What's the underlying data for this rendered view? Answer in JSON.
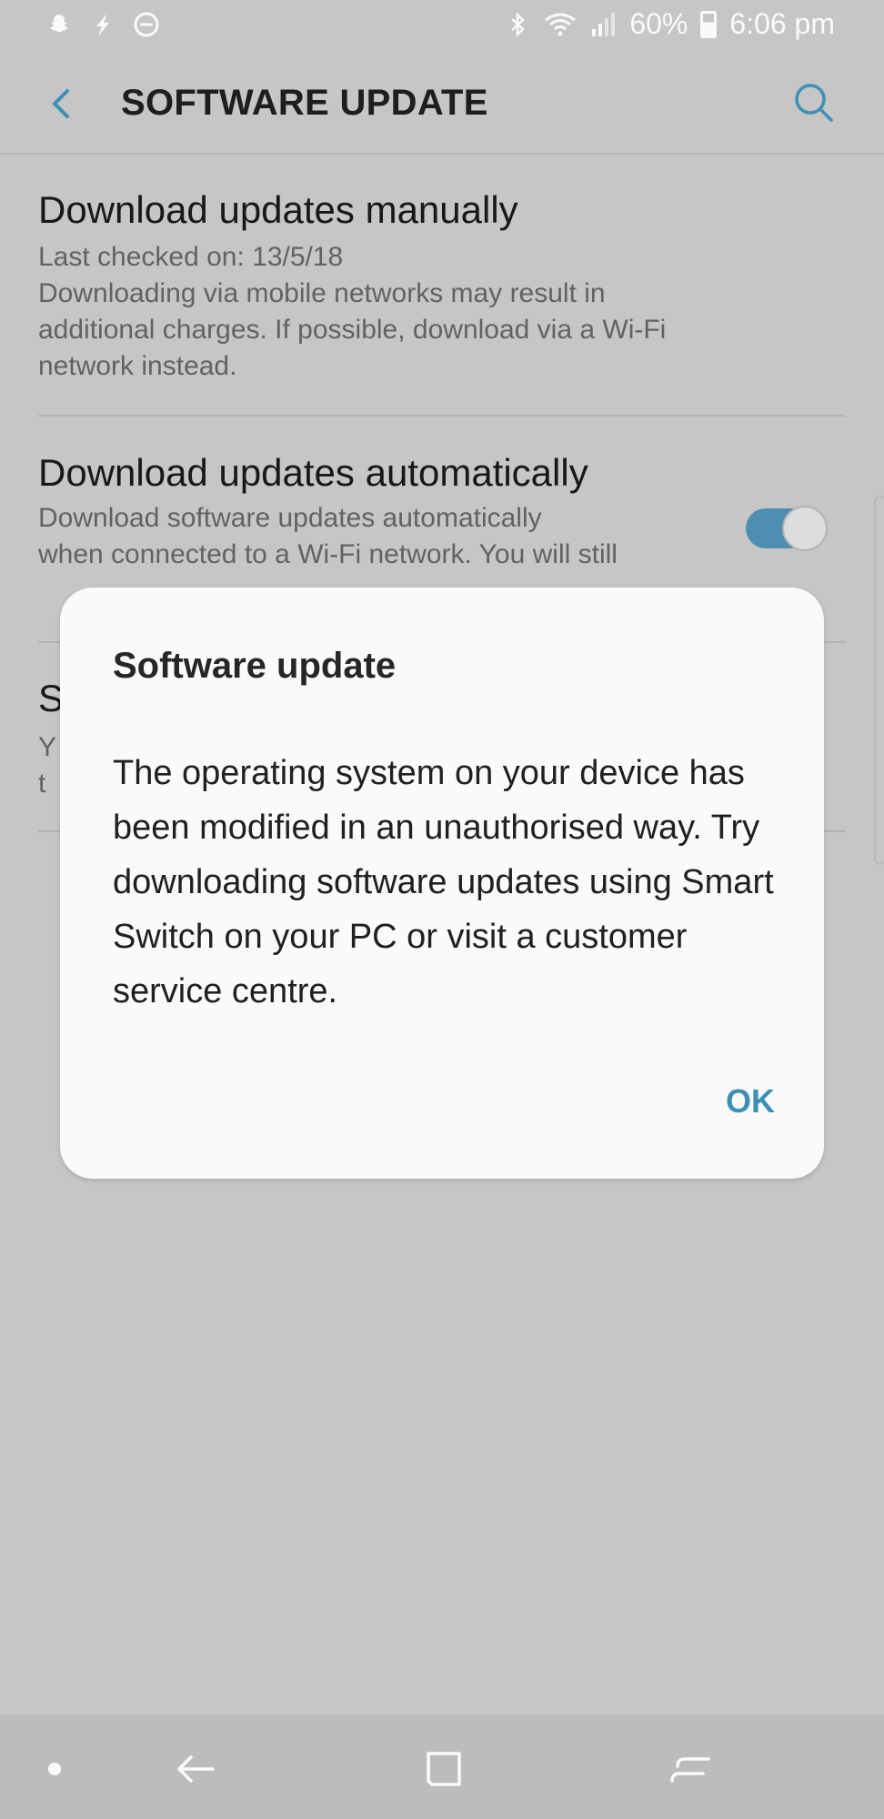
{
  "status_bar": {
    "left_icons": [
      "snapchat-icon",
      "flash-icon",
      "do-not-disturb-icon"
    ],
    "right_icons": [
      "bluetooth-icon",
      "wifi-icon",
      "signal-icon",
      "battery-icon"
    ],
    "battery_percent": "60%",
    "time": "6:06 pm"
  },
  "app_bar": {
    "title": "SOFTWARE UPDATE",
    "back_icon": "back-arrow-icon",
    "search_icon": "search-icon"
  },
  "settings": [
    {
      "title": "Download updates manually",
      "lines": [
        "Last checked on: 13/5/18",
        "Downloading via mobile networks may result in",
        "additional charges. If possible, download via a Wi-Fi",
        "network instead."
      ]
    },
    {
      "title": "Download updates automatically",
      "lines": [
        "Download software updates automatically",
        "when connected to a Wi-Fi network. You will still"
      ],
      "toggle_on": true
    },
    {
      "title_initial": "S",
      "line_initials": [
        "Y",
        "t"
      ]
    }
  ],
  "dialog": {
    "title": "Software update",
    "message": "The operating system on your device has been modified in an unauthorised way. Try downloading software updates using Smart Switch on your PC or visit a customer service centre.",
    "ok_label": "OK"
  },
  "nav_bar": {
    "icons": [
      "dot-icon",
      "back-icon",
      "home-icon",
      "recents-icon"
    ]
  },
  "colors": {
    "accent": "#3e8fb5",
    "dim_background": "#c6c6c6",
    "dialog_background": "#fafafa"
  }
}
